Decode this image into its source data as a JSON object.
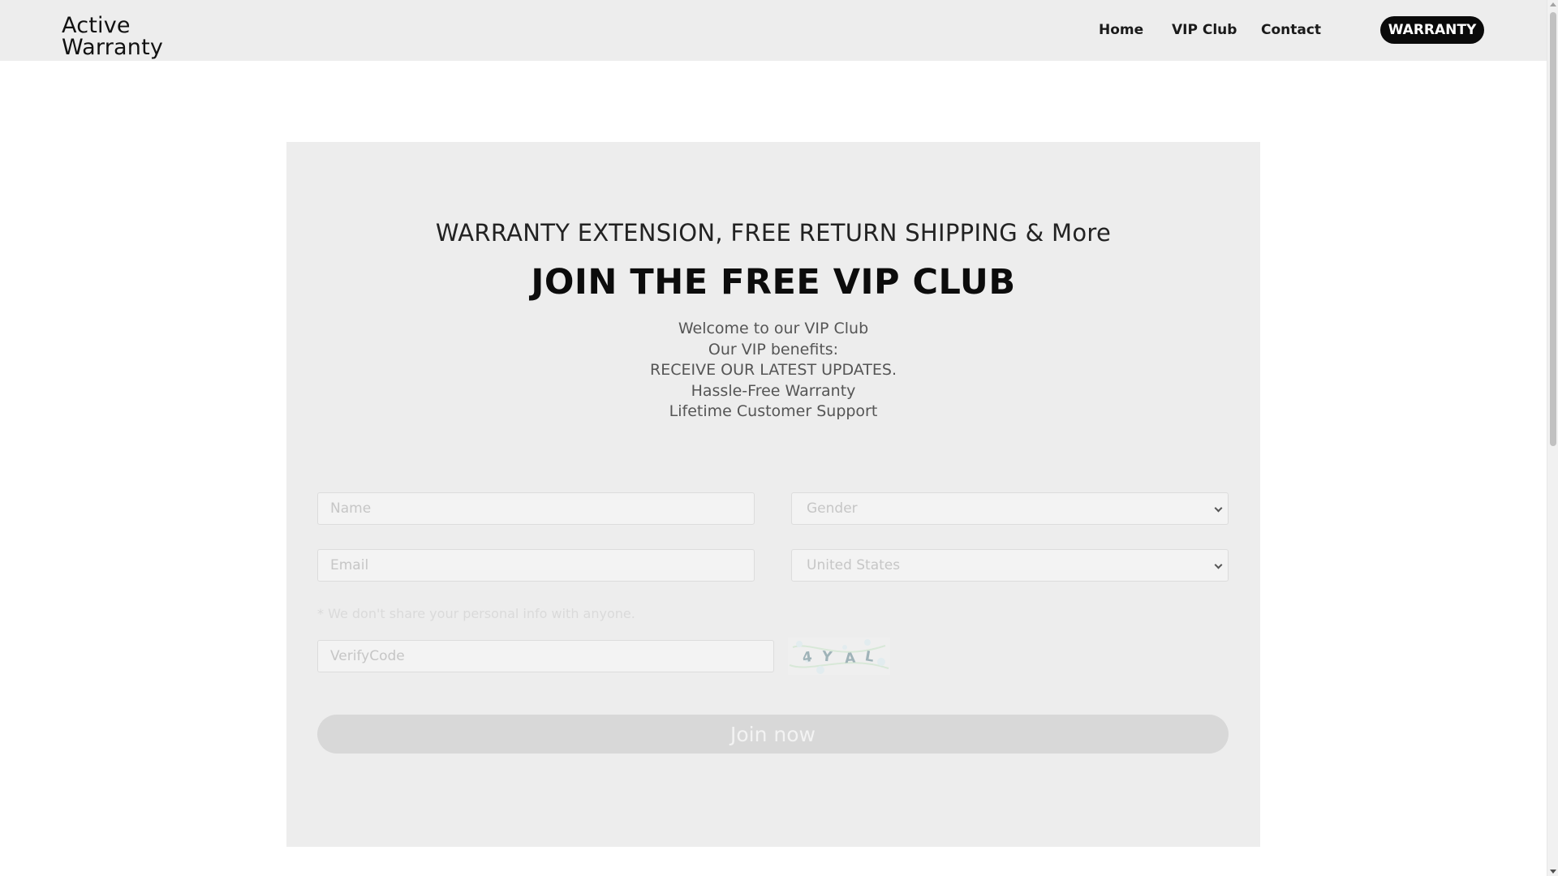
{
  "header": {
    "logo_line1": "Active",
    "logo_line2": "Warranty",
    "nav": [
      "Home",
      "VIP Club",
      "Contact"
    ],
    "warranty_button": "WARRANTY"
  },
  "card": {
    "subtitle": "WARRANTY EXTENSION, FREE RETURN SHIPPING & More",
    "title": "JOIN THE FREE VIP CLUB",
    "benefits": [
      "Welcome to our VIP Club",
      "Our VIP benefits:",
      "RECEIVE OUR LATEST UPDATES.",
      "Hassle-Free Warranty",
      "Lifetime Customer Support"
    ]
  },
  "form": {
    "name_placeholder": "Name",
    "gender_placeholder": "Gender",
    "email_placeholder": "Email",
    "country_value": "United States",
    "privacy_note": "* We don't share your personal info with anyone.",
    "verify_placeholder": "VerifyCode",
    "captcha_text": "4YAL",
    "submit_label": "Join now"
  },
  "colors": {
    "header_bg": "#ededed",
    "card_bg": "#ededed",
    "accent_button": "#0a0a0a",
    "submit_bg": "#d8d8d8"
  }
}
